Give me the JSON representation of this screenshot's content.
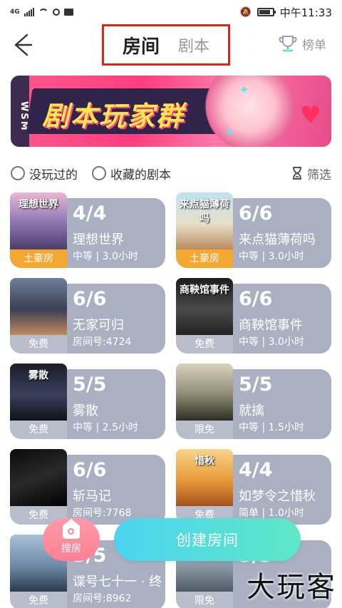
{
  "statusbar": {
    "network": "4G",
    "time": "中午11:33",
    "battery_level": 0.85
  },
  "header": {
    "tabs": [
      {
        "label": "房间",
        "active": true
      },
      {
        "label": "剧本",
        "active": false
      }
    ],
    "rank_label": "榜单",
    "accent_color": "#5fe8e0",
    "highlight_box_color": "#e2231a"
  },
  "banner": {
    "side_label": "WSM",
    "title": "剧本玩家群"
  },
  "filters": {
    "not_played": "没玩过的",
    "favorites": "收藏的剧本",
    "screen": "筛选"
  },
  "rooms": [
    {
      "count": "4/4",
      "name": "理想世界",
      "meta": "中等 | 3.0小时",
      "tag": "土豪房",
      "tag_style": "gold",
      "art_title": "理想世界",
      "art": "city"
    },
    {
      "count": "6/6",
      "name": "来点猫薄荷吗",
      "meta": "中等 | 3.0小时",
      "tag": "土豪房",
      "tag_style": "gold",
      "art_title": "来点猫薄荷吗",
      "art": "cats"
    },
    {
      "count": "6/6",
      "name": "无家可归",
      "meta": "房间号:4724",
      "tag": "免费",
      "tag_style": "grey",
      "art_title": "",
      "art": "street"
    },
    {
      "count": "6/6",
      "name": "商鞅馆事件",
      "meta": "中等 | 3.0小时",
      "tag": "免费",
      "tag_style": "grey",
      "art_title": "商鞅馆事件",
      "art": "mansion"
    },
    {
      "count": "5/5",
      "name": "雾散",
      "meta": "中等 | 2.5小时",
      "tag": "免费",
      "tag_style": "grey",
      "art_title": "雾散",
      "art": "fog"
    },
    {
      "count": "5/5",
      "name": "就擒",
      "meta": "中等 | 1.5小时",
      "tag": "限免",
      "tag_style": "grey",
      "art_title": "",
      "art": "soldiers"
    },
    {
      "count": "6/6",
      "name": "斩马记",
      "meta": "房间号:7768",
      "tag": "免费",
      "tag_style": "grey",
      "art_title": "",
      "art": "sword"
    },
    {
      "count": "4/4",
      "name": "如梦令之惜秋",
      "meta": "简单 | 1.0小时",
      "tag": "免费",
      "tag_style": "grey",
      "art_title": "惜秋",
      "art": "autumn"
    },
    {
      "count": "5/5",
      "name": "谍号七十一 · 终",
      "meta": "房间号:8962",
      "tag": "免费",
      "tag_style": "grey",
      "art_title": "",
      "art": "car"
    },
    {
      "count": "5/5",
      "name": "",
      "meta": "",
      "tag": "限免",
      "tag_style": "grey",
      "art_title": "",
      "art": "lake"
    }
  ],
  "actions": {
    "search_label": "搜房",
    "create_label": "创建房间"
  },
  "watermark": "大玩客"
}
